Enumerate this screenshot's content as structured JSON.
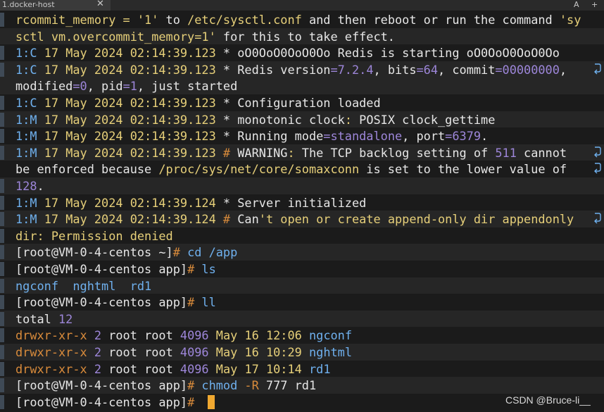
{
  "tab": {
    "title": "1.docker-host",
    "close_icon": "close-icon"
  },
  "toolbar": {
    "font_size_label": "A",
    "more_label": "+"
  },
  "terminal": {
    "lines": [
      {
        "segments": [
          {
            "t": "rcommit_memory = ",
            "c": "yellow"
          },
          {
            "t": "'1'",
            "c": "yellow"
          },
          {
            "t": " to ",
            "c": "white"
          },
          {
            "t": "/etc/sysctl.conf",
            "c": "yellow"
          },
          {
            "t": " and then reboot or run the command ",
            "c": "white"
          },
          {
            "t": "'sy",
            "c": "yellow"
          }
        ]
      },
      {
        "segments": [
          {
            "t": "sctl vm.overcommit_memory=1'",
            "c": "yellow"
          },
          {
            "t": " for this to take effect.",
            "c": "white"
          }
        ]
      },
      {
        "segments": [
          {
            "t": "1:C ",
            "c": "cyan"
          },
          {
            "t": "17 May 2024 02:14:39.123 ",
            "c": "yellow"
          },
          {
            "t": "* ",
            "c": "white"
          },
          {
            "t": "oO0OoO0OoO0Oo Redis is starting oO0OoO0OoO0Oo",
            "c": "white"
          }
        ]
      },
      {
        "segments": [
          {
            "t": "1:C ",
            "c": "cyan"
          },
          {
            "t": "17 May 2024 02:14:39.123 ",
            "c": "yellow"
          },
          {
            "t": "* ",
            "c": "white"
          },
          {
            "t": "Redis version",
            "c": "white"
          },
          {
            "t": "=7.2.4",
            "c": "purple"
          },
          {
            "t": ", bits",
            "c": "white"
          },
          {
            "t": "=64",
            "c": "purple"
          },
          {
            "t": ", commit",
            "c": "white"
          },
          {
            "t": "=00000000",
            "c": "purple"
          },
          {
            "t": ",",
            "c": "white"
          }
        ],
        "wrap": true
      },
      {
        "segments": [
          {
            "t": "modified",
            "c": "white"
          },
          {
            "t": "=0",
            "c": "purple"
          },
          {
            "t": ", pid",
            "c": "white"
          },
          {
            "t": "=1",
            "c": "purple"
          },
          {
            "t": ", just started",
            "c": "white"
          }
        ]
      },
      {
        "segments": [
          {
            "t": "1:C ",
            "c": "cyan"
          },
          {
            "t": "17 May 2024 02:14:39.123 ",
            "c": "yellow"
          },
          {
            "t": "* ",
            "c": "white"
          },
          {
            "t": "Configuration loaded",
            "c": "white"
          }
        ]
      },
      {
        "segments": [
          {
            "t": "1:M ",
            "c": "cyan"
          },
          {
            "t": "17 May 2024 02:14:39.123 ",
            "c": "yellow"
          },
          {
            "t": "* ",
            "c": "white"
          },
          {
            "t": "monotonic clock",
            "c": "white"
          },
          {
            "t": ":",
            "c": "yellow"
          },
          {
            "t": " POSIX clock_gettime",
            "c": "white"
          }
        ]
      },
      {
        "segments": [
          {
            "t": "1:M ",
            "c": "cyan"
          },
          {
            "t": "17 May 2024 02:14:39.123 ",
            "c": "yellow"
          },
          {
            "t": "* ",
            "c": "white"
          },
          {
            "t": "Running mode",
            "c": "white"
          },
          {
            "t": "=standalone",
            "c": "purple"
          },
          {
            "t": ", port",
            "c": "white"
          },
          {
            "t": "=6379",
            "c": "purple"
          },
          {
            "t": ".",
            "c": "white"
          }
        ]
      },
      {
        "segments": [
          {
            "t": "1:M ",
            "c": "cyan"
          },
          {
            "t": "17 May 2024 02:14:39.123 ",
            "c": "yellow"
          },
          {
            "t": "# ",
            "c": "orange"
          },
          {
            "t": "WARNING",
            "c": "white"
          },
          {
            "t": ":",
            "c": "yellow"
          },
          {
            "t": " The TCP backlog setting of ",
            "c": "white"
          },
          {
            "t": "511",
            "c": "purple"
          },
          {
            "t": " cannot",
            "c": "white"
          }
        ],
        "wrap": true
      },
      {
        "segments": [
          {
            "t": "be enforced because ",
            "c": "white"
          },
          {
            "t": "/proc/sys/net/core/somaxconn",
            "c": "yellow"
          },
          {
            "t": " is set to the lower value of",
            "c": "white"
          }
        ],
        "wrap": true
      },
      {
        "segments": [
          {
            "t": "128",
            "c": "purple"
          },
          {
            "t": ".",
            "c": "white"
          }
        ]
      },
      {
        "segments": [
          {
            "t": "1:M ",
            "c": "cyan"
          },
          {
            "t": "17 May 2024 02:14:39.124 ",
            "c": "yellow"
          },
          {
            "t": "* ",
            "c": "white"
          },
          {
            "t": "Server initialized",
            "c": "white"
          }
        ]
      },
      {
        "segments": [
          {
            "t": "1:M ",
            "c": "cyan"
          },
          {
            "t": "17 May 2024 02:14:39.124 ",
            "c": "yellow"
          },
          {
            "t": "# ",
            "c": "orange"
          },
          {
            "t": "Can",
            "c": "white"
          },
          {
            "t": "'t open or create append-only dir appendonly",
            "c": "yellow"
          }
        ],
        "wrap": true
      },
      {
        "segments": [
          {
            "t": "dir: Permission denied",
            "c": "yellow"
          }
        ]
      },
      {
        "segments": [
          {
            "t": "[root@VM-0-4-centos ~]",
            "c": "white"
          },
          {
            "t": "# ",
            "c": "orange"
          },
          {
            "t": "cd /app",
            "c": "cyan"
          }
        ]
      },
      {
        "segments": [
          {
            "t": "[root@VM-0-4-centos app]",
            "c": "white"
          },
          {
            "t": "# ",
            "c": "orange"
          },
          {
            "t": "ls",
            "c": "cyan"
          }
        ]
      },
      {
        "segments": [
          {
            "t": "ngconf  nghtml  rd1",
            "c": "cyan"
          }
        ]
      },
      {
        "segments": [
          {
            "t": "[root@VM-0-4-centos app]",
            "c": "white"
          },
          {
            "t": "# ",
            "c": "orange"
          },
          {
            "t": "ll",
            "c": "cyan"
          }
        ]
      },
      {
        "segments": [
          {
            "t": "total ",
            "c": "white"
          },
          {
            "t": "12",
            "c": "purple"
          }
        ]
      },
      {
        "segments": [
          {
            "t": "drwxr-xr-x",
            "c": "orange"
          },
          {
            "t": " 2 ",
            "c": "purple"
          },
          {
            "t": "root root ",
            "c": "white"
          },
          {
            "t": "4096",
            "c": "purple"
          },
          {
            "t": " May 16 12:06 ",
            "c": "yellow"
          },
          {
            "t": "ngconf",
            "c": "cyan"
          }
        ]
      },
      {
        "segments": [
          {
            "t": "drwxr-xr-x",
            "c": "orange"
          },
          {
            "t": " 2 ",
            "c": "purple"
          },
          {
            "t": "root root ",
            "c": "white"
          },
          {
            "t": "4096",
            "c": "purple"
          },
          {
            "t": " May 16 10:29 ",
            "c": "yellow"
          },
          {
            "t": "nghtml",
            "c": "cyan"
          }
        ]
      },
      {
        "segments": [
          {
            "t": "drwxr-xr-x",
            "c": "orange"
          },
          {
            "t": " 2 ",
            "c": "purple"
          },
          {
            "t": "root root ",
            "c": "white"
          },
          {
            "t": "4096",
            "c": "purple"
          },
          {
            "t": " May 17 10:14 ",
            "c": "yellow"
          },
          {
            "t": "rd1",
            "c": "cyan"
          }
        ]
      },
      {
        "segments": [
          {
            "t": "[root@VM-0-4-centos app]",
            "c": "white"
          },
          {
            "t": "# ",
            "c": "orange"
          },
          {
            "t": "chmod ",
            "c": "cyan"
          },
          {
            "t": "-R",
            "c": "orange"
          },
          {
            "t": " 777 ",
            "c": "white"
          },
          {
            "t": "rd1",
            "c": "white"
          }
        ]
      },
      {
        "segments": [
          {
            "t": "[root@VM-0-4-centos app]",
            "c": "white"
          },
          {
            "t": "# ",
            "c": "orange"
          }
        ],
        "cursor": true
      }
    ]
  },
  "watermark": "CSDN @Bruce-li__",
  "colors": {
    "background": "#1b1b1b",
    "prompt_yellow": "#e6cf79",
    "cyan": "#6fb0ee",
    "purple": "#9d86d9",
    "orange": "#d98b3b",
    "cursor": "#f0a830"
  }
}
